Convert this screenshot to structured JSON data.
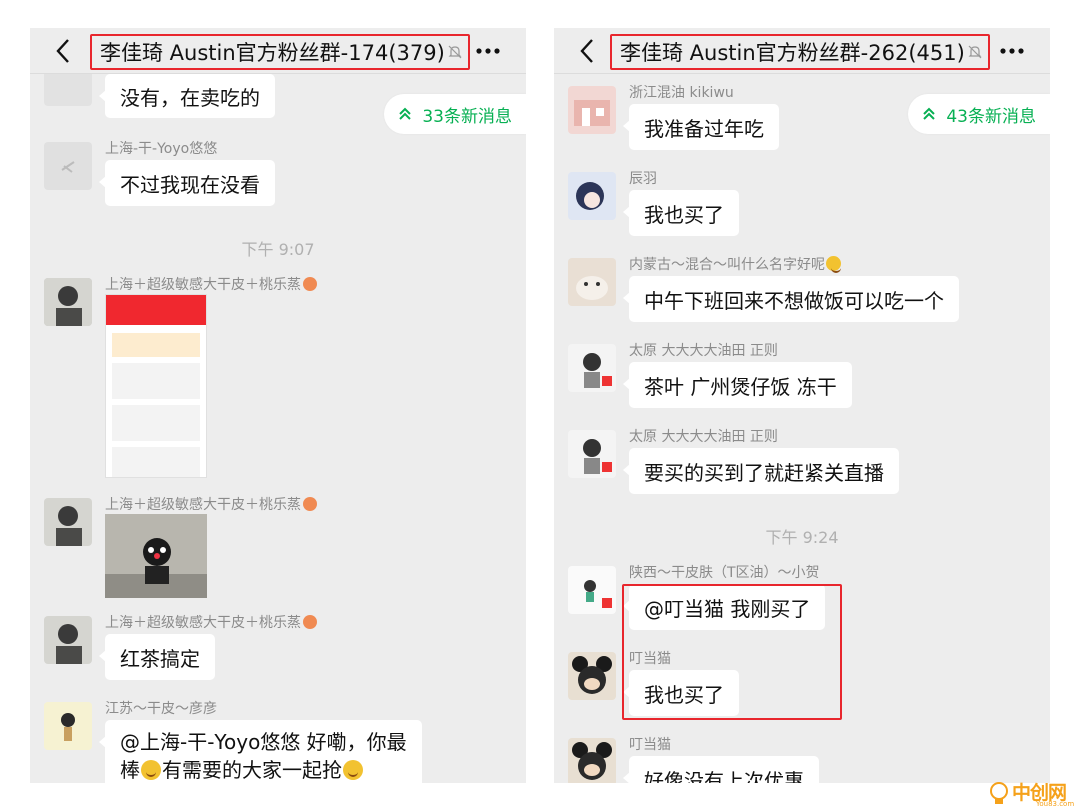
{
  "left": {
    "title": "李佳琦 Austin官方粉丝群-174(379)",
    "new_messages": "33条新消息",
    "messages": [
      {
        "sender": "",
        "text": "没有，在卖吃的"
      },
      {
        "sender": "上海-干-Yoyo悠悠",
        "text": "不过我现在没看"
      },
      {
        "time": "下午 9:07"
      },
      {
        "sender": "上海＋超级敏感大干皮＋桃乐蒸",
        "image": "shopping-screenshot"
      },
      {
        "sender": "上海＋超级敏感大干皮＋桃乐蒸",
        "image": "kumamon-photo"
      },
      {
        "sender": "上海＋超级敏感大干皮＋桃乐蒸",
        "text": "红茶搞定"
      },
      {
        "sender": "江苏～干皮～彦彦",
        "text_line1": "@上海-干-Yoyo悠悠 好嘞，你最",
        "text_line2_a": "棒",
        "text_line2_b": "有需要的大家一起抢"
      }
    ]
  },
  "right": {
    "title": "李佳琦 Austin官方粉丝群-262(451)",
    "new_messages": "43条新消息",
    "messages": [
      {
        "sender": "浙江混油 kikiwu",
        "text": "我准备过年吃"
      },
      {
        "sender": "辰羽",
        "text": "我也买了"
      },
      {
        "sender": "内蒙古～混合～叫什么名字好呢",
        "text": "中午下班回来不想做饭可以吃一个"
      },
      {
        "sender": "太原 大大大大油田 正则",
        "text": "茶叶 广州煲仔饭 冻干"
      },
      {
        "sender": "太原 大大大大油田 正则",
        "text": "要买的买到了就赶紧关直播"
      },
      {
        "time": "下午 9:24"
      },
      {
        "sender": "陕西～干皮肤（T区油）～小贺",
        "text": "@叮当猫 我刚买了"
      },
      {
        "sender": "叮当猫",
        "text": "我也买了"
      },
      {
        "sender": "叮当猫",
        "text": "好像没有上次优惠"
      }
    ]
  },
  "watermark": {
    "main": "中创网",
    "sub": "You83.com"
  },
  "colors": {
    "highlight": "#e8262d",
    "badge_text": "#07b053",
    "chat_bg": "#ededed"
  }
}
